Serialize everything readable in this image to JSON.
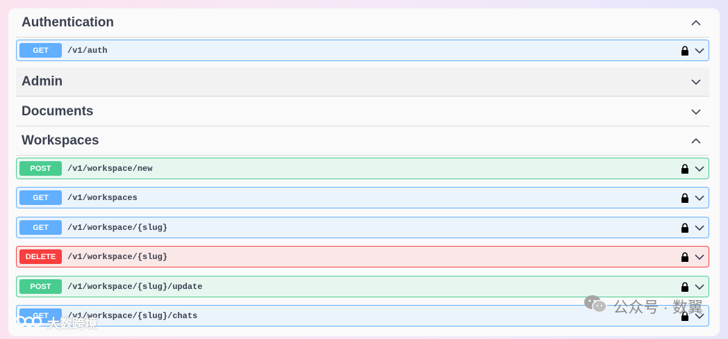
{
  "tags": [
    {
      "name": "Authentication",
      "expanded": true
    },
    {
      "name": "Admin",
      "expanded": false
    },
    {
      "name": "Documents",
      "expanded": false
    },
    {
      "name": "Workspaces",
      "expanded": true
    }
  ],
  "auth_ops": [
    {
      "method": "GET",
      "path": "/v1/auth"
    }
  ],
  "workspace_ops": [
    {
      "method": "POST",
      "path": "/v1/workspace/new"
    },
    {
      "method": "GET",
      "path": "/v1/workspaces"
    },
    {
      "method": "GET",
      "path": "/v1/workspace/{slug}"
    },
    {
      "method": "DELETE",
      "path": "/v1/workspace/{slug}"
    },
    {
      "method": "POST",
      "path": "/v1/workspace/{slug}/update"
    },
    {
      "method": "GET",
      "path": "/v1/workspace/{slug}/chats"
    }
  ],
  "watermarks": {
    "right": "公众号 · 数翼",
    "left": "大数跨境"
  },
  "icons": {
    "expanded": "chevron-up-icon",
    "collapsed": "chevron-down-icon",
    "lock": "lock-icon"
  },
  "colors": {
    "get": "#61affe",
    "post": "#49cc90",
    "delete": "#f93e3e"
  }
}
